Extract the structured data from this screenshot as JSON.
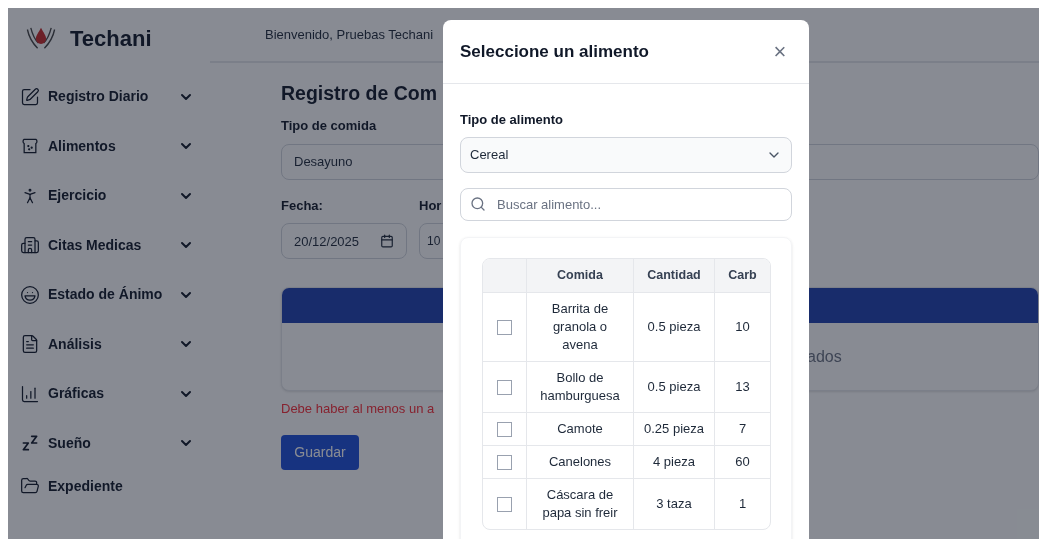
{
  "brand": {
    "name": "Techani"
  },
  "header": {
    "greeting": "Bienvenido, Pruebas Techani"
  },
  "sidebar": {
    "items": [
      {
        "label": "Registro Diario",
        "expandable": true
      },
      {
        "label": "Alimentos",
        "expandable": true
      },
      {
        "label": "Ejercicio",
        "expandable": true
      },
      {
        "label": "Citas Medicas",
        "expandable": true
      },
      {
        "label": "Estado de Ánimo",
        "expandable": true
      },
      {
        "label": "Análisis",
        "expandable": true
      },
      {
        "label": "Gráficas",
        "expandable": true
      },
      {
        "label": "Sueño",
        "expandable": true
      },
      {
        "label": "Expediente",
        "expandable": false
      }
    ]
  },
  "form": {
    "title": "Registro de Com",
    "meal_type_label": "Tipo de comida",
    "meal_type_value": "Desayuno",
    "date_label": "Fecha:",
    "date_value": "20/12/2025",
    "time_label": "Hor",
    "time_value": "10",
    "card_text": "ados",
    "error": "Debe haber al menos un a",
    "save_button": "Guardar"
  },
  "modal": {
    "title": "Seleccione un alimento",
    "close": "×",
    "type_label": "Tipo de alimento",
    "type_value": "Cereal",
    "search_placeholder": "Buscar alimento...",
    "table": {
      "columns": [
        "",
        "Comida",
        "Cantidad",
        "Carb"
      ],
      "rows": [
        {
          "checked": false,
          "comida": "Barrita de granola o avena",
          "cantidad": "0.5 pieza",
          "carb": "10"
        },
        {
          "checked": false,
          "comida": "Bollo de hamburguesa",
          "cantidad": "0.5 pieza",
          "carb": "13"
        },
        {
          "checked": false,
          "comida": "Camote",
          "cantidad": "0.25 pieza",
          "carb": "7"
        },
        {
          "checked": false,
          "comida": "Canelones",
          "cantidad": "4 pieza",
          "carb": "60"
        },
        {
          "checked": false,
          "comida": "Cáscara de papa sin freir",
          "cantidad": "3 taza",
          "carb": "1"
        }
      ]
    }
  }
}
